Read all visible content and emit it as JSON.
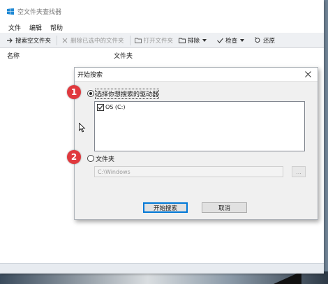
{
  "window": {
    "title": "空文件夹查找器"
  },
  "menu": [
    "文件",
    "编辑",
    "帮助"
  ],
  "toolbar": {
    "search": "搜索空文件夹",
    "delete_selected": "删除已选中的文件夹",
    "open_folder": "打开文件夹",
    "exclude": "排除",
    "check": "检查",
    "restore": "还原"
  },
  "columns": {
    "name": "名称",
    "folder": "文件夹"
  },
  "dialog": {
    "title": "开始搜索",
    "option_drives": "选择你想搜索的驱动器",
    "drives": [
      {
        "label": "OS (C:)",
        "checked": true
      }
    ],
    "option_folder": "文件夹",
    "folder_path": "C:\\Windows",
    "browse": "...",
    "start_button": "开始搜索",
    "cancel_button": "取消"
  },
  "badges": [
    "1",
    "2"
  ],
  "colors": {
    "badge": "#e0393e",
    "accent": "#0078d7"
  }
}
